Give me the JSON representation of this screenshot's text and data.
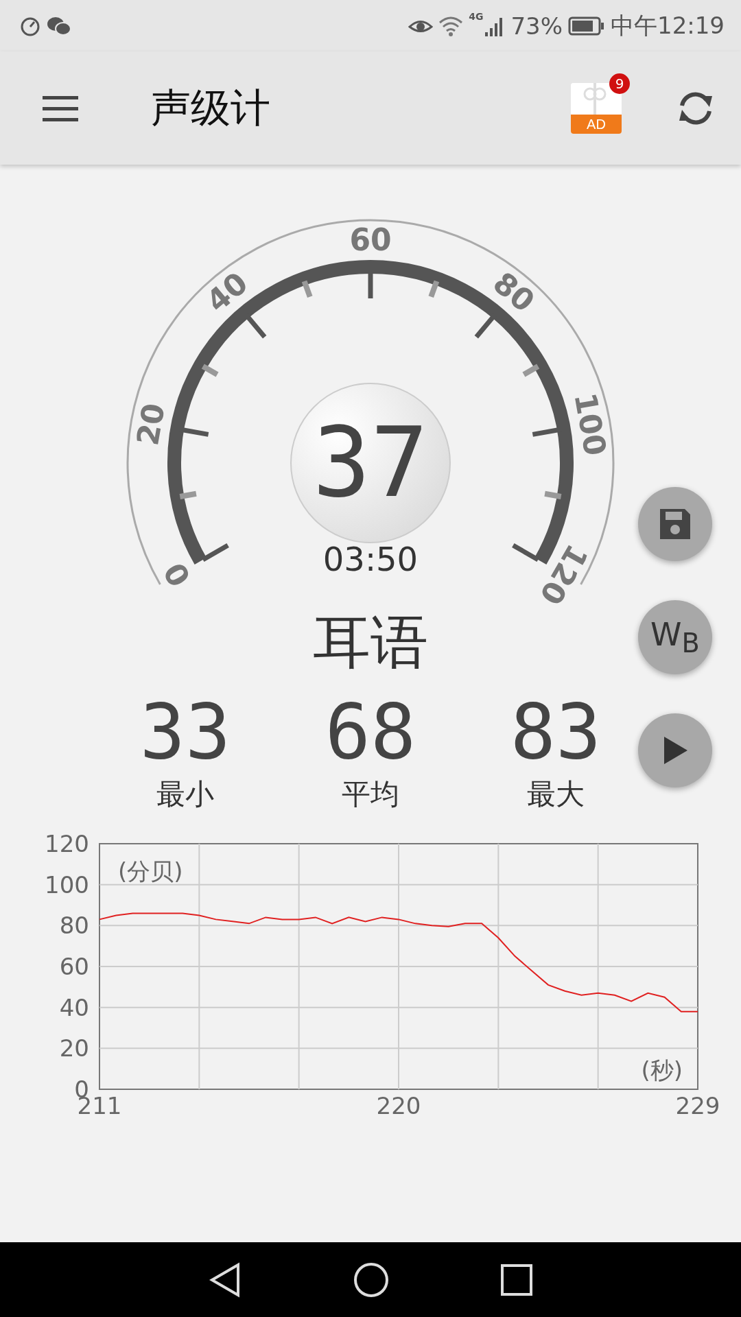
{
  "status_bar": {
    "network": "4G",
    "battery": "73%",
    "time": "中午12:19"
  },
  "app_bar": {
    "title": "声级计",
    "ad_badge": {
      "label": "AD",
      "count": "9"
    }
  },
  "gauge": {
    "scale_labels": [
      "0",
      "20",
      "40",
      "60",
      "80",
      "100",
      "120"
    ],
    "reading": "37",
    "elapsed": "03:50"
  },
  "noise_description": "耳语",
  "stats": [
    {
      "value": "33",
      "label": "最小"
    },
    {
      "value": "68",
      "label": "平均"
    },
    {
      "value": "83",
      "label": "最大"
    }
  ],
  "side_buttons": [
    {
      "kind": "save"
    },
    {
      "kind": "weighting",
      "label": "W$_{B}$"
    },
    {
      "kind": "play"
    }
  ],
  "chart": {
    "chart_data": {
      "type": "line",
      "ylabel": "(分贝)",
      "xlabel": "(秒)",
      "x": [
        211,
        211.5,
        212,
        212.5,
        213,
        213.5,
        214,
        214.5,
        215,
        215.5,
        216,
        216.5,
        217,
        217.5,
        218,
        218.5,
        219,
        219.5,
        220,
        220.5,
        221,
        221.5,
        222,
        222.5,
        223,
        223.5,
        224,
        224.5,
        225,
        225.5,
        226,
        226.5,
        227,
        227.5,
        228,
        228.5,
        229
      ],
      "series": [
        {
          "color": "#e02020",
          "values": [
            83,
            85,
            86,
            86,
            86,
            86,
            85,
            83,
            82,
            81,
            84,
            83,
            83,
            84,
            81,
            84,
            82,
            84,
            83,
            81,
            80,
            79.5,
            81,
            81,
            74,
            65,
            58,
            51,
            48,
            46,
            47,
            46,
            43,
            47,
            45,
            38,
            38
          ]
        }
      ],
      "xlim": [
        211,
        229
      ],
      "ylim": [
        0,
        120
      ],
      "grid": true,
      "xticks": [
        211,
        220,
        229
      ],
      "yticks": [
        0,
        20,
        40,
        60,
        80,
        100,
        120
      ]
    }
  }
}
